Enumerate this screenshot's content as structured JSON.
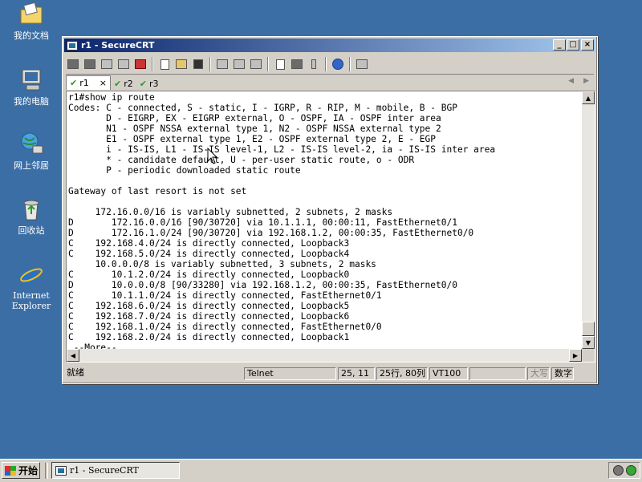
{
  "desktop": {
    "icons": [
      {
        "label": "我的文档",
        "icon": "my-documents-icon"
      },
      {
        "label": "我的电脑",
        "icon": "my-computer-icon"
      },
      {
        "label": "网上邻居",
        "icon": "network-places-icon"
      },
      {
        "label": "回收站",
        "icon": "recycle-bin-icon"
      },
      {
        "label": "Internet Explorer",
        "icon": "internet-explorer-icon"
      }
    ]
  },
  "window": {
    "title": "r1 - SecureCRT",
    "tabs": [
      {
        "label": "r1",
        "active": true
      },
      {
        "label": "r2",
        "active": false
      },
      {
        "label": "r3",
        "active": false
      }
    ],
    "tab_close": "×",
    "terminal_lines": [
      "r1#show ip route",
      "Codes: C - connected, S - static, I - IGRP, R - RIP, M - mobile, B - BGP",
      "       D - EIGRP, EX - EIGRP external, O - OSPF, IA - OSPF inter area",
      "       N1 - OSPF NSSA external type 1, N2 - OSPF NSSA external type 2",
      "       E1 - OSPF external type 1, E2 - OSPF external type 2, E - EGP",
      "       i - IS-IS, L1 - IS-IS level-1, L2 - IS-IS level-2, ia - IS-IS inter area",
      "       * - candidate default, U - per-user static route, o - ODR",
      "       P - periodic downloaded static route",
      "",
      "Gateway of last resort is not set",
      "",
      "     172.16.0.0/16 is variably subnetted, 2 subnets, 2 masks",
      "D       172.16.0.0/16 [90/30720] via 10.1.1.1, 00:00:11, FastEthernet0/1",
      "D       172.16.1.0/24 [90/30720] via 192.168.1.2, 00:00:35, FastEthernet0/0",
      "C    192.168.4.0/24 is directly connected, Loopback3",
      "C    192.168.5.0/24 is directly connected, Loopback4",
      "     10.0.0.0/8 is variably subnetted, 3 subnets, 2 masks",
      "C       10.1.2.0/24 is directly connected, Loopback0",
      "D       10.0.0.0/8 [90/33280] via 192.168.1.2, 00:00:35, FastEthernet0/0",
      "C       10.1.1.0/24 is directly connected, FastEthernet0/1",
      "C    192.168.6.0/24 is directly connected, Loopback5",
      "C    192.168.7.0/24 is directly connected, Loopback6",
      "C    192.168.1.0/24 is directly connected, FastEthernet0/0",
      "C    192.168.2.0/24 is directly connected, Loopback1",
      " --More--"
    ],
    "status": {
      "ready": "就绪",
      "protocol": "Telnet",
      "cursor_pos": "25, 11",
      "size": "25行, 80列",
      "emulation": "VT100",
      "caps": "大写",
      "num": "数字"
    }
  },
  "taskbar": {
    "start_label": "开始",
    "task_label": "r1 - SecureCRT"
  }
}
